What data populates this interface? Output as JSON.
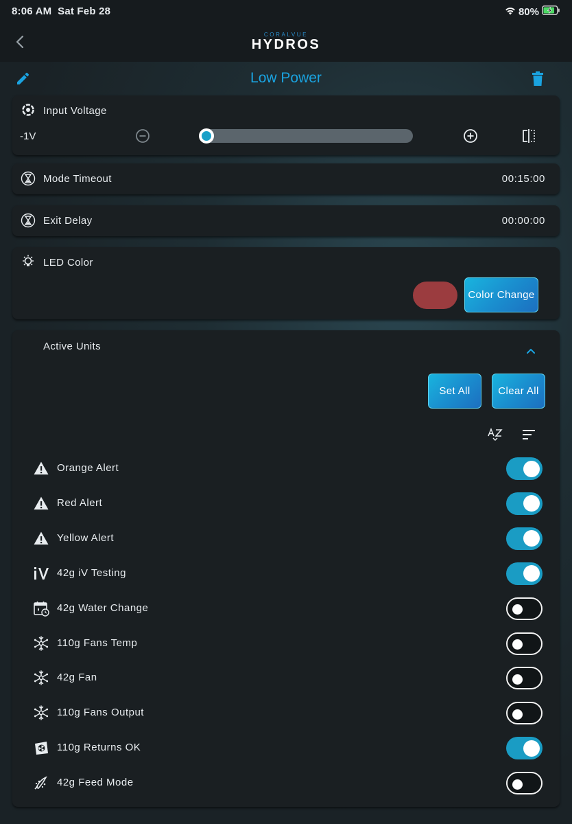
{
  "status": {
    "time": "8:06 AM",
    "date": "Sat Feb 28",
    "battery": "80%"
  },
  "app": {
    "logo_top": "CORALVUE",
    "logo_main": "HYDROS"
  },
  "page": {
    "title": "Low Power"
  },
  "input_voltage": {
    "label": "Input Voltage",
    "value": "-1V",
    "slider_level": 0
  },
  "mode_timeout": {
    "label": "Mode Timeout",
    "value": "00:15:00"
  },
  "exit_delay": {
    "label": "Exit Delay",
    "value": "00:00:00"
  },
  "led_color": {
    "label": "LED Color",
    "swatch_color": "#9b3c3f",
    "button_label": "Color Change"
  },
  "active_units": {
    "label": "Active Units",
    "set_all_label": "Set All",
    "clear_all_label": "Clear All",
    "units": [
      {
        "name": "Orange Alert",
        "icon": "warning-icon",
        "enabled": true
      },
      {
        "name": "Red Alert",
        "icon": "warning-icon",
        "enabled": true
      },
      {
        "name": "Yellow Alert",
        "icon": "warning-icon",
        "enabled": true
      },
      {
        "name": "42g iV Testing",
        "icon": "iv-icon",
        "enabled": true
      },
      {
        "name": "42g Water Change",
        "icon": "calendar-icon",
        "enabled": false
      },
      {
        "name": "110g Fans Temp",
        "icon": "snowflake-icon",
        "enabled": false
      },
      {
        "name": "42g Fan",
        "icon": "snowflake-icon",
        "enabled": false
      },
      {
        "name": "110g Fans Output",
        "icon": "snowflake-icon",
        "enabled": false
      },
      {
        "name": "110g Returns OK",
        "icon": "pump-icon",
        "enabled": true
      },
      {
        "name": "42g Feed Mode",
        "icon": "feed-icon",
        "enabled": false
      }
    ]
  },
  "colors": {
    "accent": "#1aa3e0",
    "toggle_on": "#1a9cc4",
    "card_bg": "#1a1f22"
  }
}
